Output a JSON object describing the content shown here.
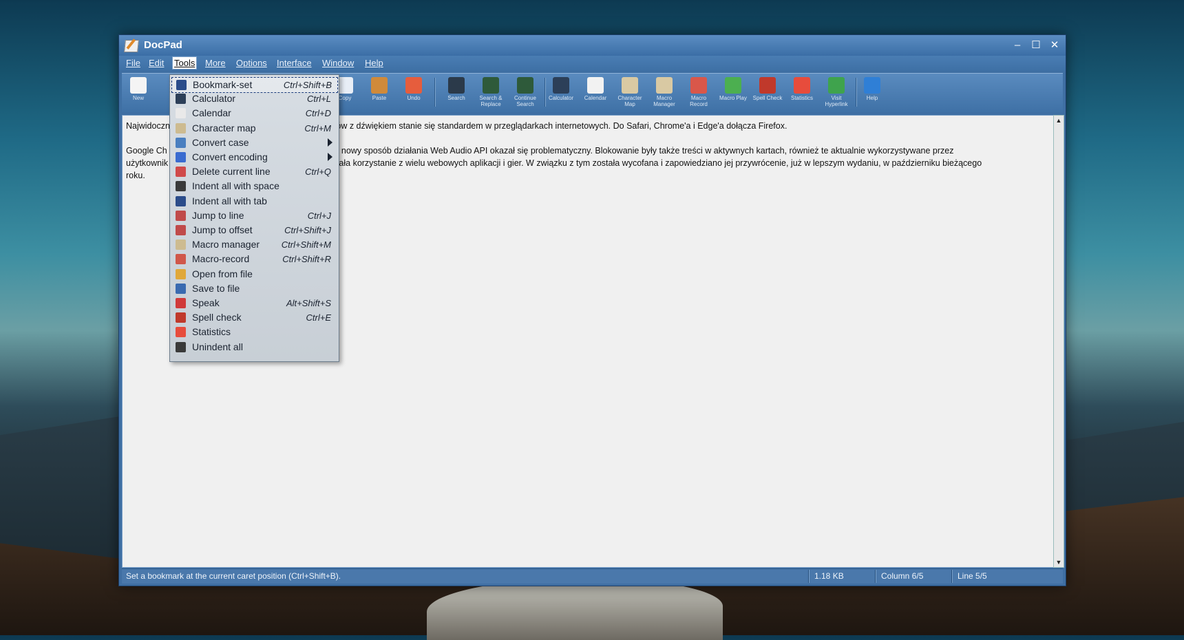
{
  "window": {
    "title": "DocPad",
    "minimize": "‒",
    "maximize": "☐",
    "close": "✕"
  },
  "menubar": [
    "File",
    "Edit",
    "Tools",
    "More",
    "Options",
    "Interface",
    "Window",
    "Help"
  ],
  "toolbar": [
    {
      "label": "New",
      "icon": "new-document-icon",
      "color": "#f4f4f4"
    },
    {
      "label": "Copy",
      "icon": "copy-icon",
      "color": "#e8eef6"
    },
    {
      "label": "Paste",
      "icon": "paste-icon",
      "color": "#d08a3a"
    },
    {
      "label": "Undo",
      "icon": "undo-icon",
      "color": "#e65d3d"
    },
    {
      "label": "Search",
      "icon": "binoculars-icon",
      "color": "#2b3a4a"
    },
    {
      "label": "Search & Replace",
      "icon": "search-replace-icon",
      "color": "#2e5a3a"
    },
    {
      "label": "Continue Search",
      "icon": "continue-search-icon",
      "color": "#2e5a3a"
    },
    {
      "label": "Calculator",
      "icon": "calculator-icon",
      "color": "#2c3f58"
    },
    {
      "label": "Calendar",
      "icon": "calendar-icon",
      "color": "#f2f2f2"
    },
    {
      "label": "Character Map",
      "icon": "character-map-icon",
      "color": "#d9c9a3"
    },
    {
      "label": "Macro Manager",
      "icon": "macro-manager-icon",
      "color": "#d9c9a3"
    },
    {
      "label": "Macro Record",
      "icon": "macro-record-icon",
      "color": "#d9574a"
    },
    {
      "label": "Macro Play",
      "icon": "macro-play-icon",
      "color": "#4caf50"
    },
    {
      "label": "Spell Check",
      "icon": "spell-check-icon",
      "color": "#c0392b"
    },
    {
      "label": "Statistics",
      "icon": "pie-chart-icon",
      "color": "#e74c3c"
    },
    {
      "label": "Visit Hyperlink",
      "icon": "globe-icon",
      "color": "#3fa34d"
    },
    {
      "label": "Help",
      "icon": "help-icon",
      "color": "#2f7fd6"
    }
  ],
  "editor": {
    "line1_start": "Najwidoczn",
    "line1_end": "filmów z dźwiękiem stanie się standardem w przeglądarkach internetowych. Do Safari, Chrome'a i Edge'a dołącza Firefox.",
    "para2_a_start": "Google Ch",
    "para2_a_end": "ale nowy sposób działania Web Audio API okazał się problematyczny. Blokowanie były także treści w aktywnych kartach, również te aktualnie wykorzystywane przez",
    "para2_b_start": "użytkownik",
    "para2_b_end": "trudniała korzystanie z wielu webowych aplikacji i gier. W związku z tym została wycofana i zapowiedziano jej przywrócenie, już w lepszym wydaniu, w październiku bieżącego",
    "para2_c": "roku."
  },
  "tools_menu": [
    {
      "label": "Bookmark-set",
      "shortcut": "Ctrl+Shift+B",
      "icon": "bookmark-icon",
      "color": "#2a4c8a",
      "selected": true
    },
    {
      "label": "Calculator",
      "shortcut": "Ctrl+L",
      "icon": "calculator-icon",
      "color": "#2c3f58"
    },
    {
      "label": "Calendar",
      "shortcut": "Ctrl+D",
      "icon": "calendar-icon",
      "color": "#e9e9e9"
    },
    {
      "label": "Character map",
      "shortcut": "Ctrl+M",
      "icon": "character-map-icon",
      "color": "#cdbb90"
    },
    {
      "label": "Convert case",
      "shortcut": "",
      "icon": "convert-case-icon",
      "color": "#4a7fc0",
      "submenu": true
    },
    {
      "label": "Convert encoding",
      "shortcut": "",
      "icon": "convert-encoding-icon",
      "color": "#3a6bd0",
      "submenu": true
    },
    {
      "label": "Delete current line",
      "shortcut": "Ctrl+Q",
      "icon": "delete-line-icon",
      "color": "#d04a4a"
    },
    {
      "label": "Indent all with space",
      "shortcut": "",
      "icon": "indent-space-icon",
      "color": "#3a3a3a"
    },
    {
      "label": "Indent all with tab",
      "shortcut": "",
      "icon": "indent-tab-icon",
      "color": "#2b4c8a"
    },
    {
      "label": "Jump to line",
      "shortcut": "Ctrl+J",
      "icon": "jump-line-icon",
      "color": "#c04a4a"
    },
    {
      "label": "Jump to offset",
      "shortcut": "Ctrl+Shift+J",
      "icon": "jump-offset-icon",
      "color": "#c04a4a"
    },
    {
      "label": "Macro manager",
      "shortcut": "Ctrl+Shift+M",
      "icon": "macro-manager-icon",
      "color": "#cdbb90"
    },
    {
      "label": "Macro-record",
      "shortcut": "Ctrl+Shift+R",
      "icon": "macro-record-icon",
      "color": "#d0574a"
    },
    {
      "label": "Open from file",
      "shortcut": "",
      "icon": "open-folder-icon",
      "color": "#e0a83a"
    },
    {
      "label": "Save to file",
      "shortcut": "",
      "icon": "save-icon",
      "color": "#3a6ab0"
    },
    {
      "label": "Speak",
      "shortcut": "Alt+Shift+S",
      "icon": "speak-icon",
      "color": "#d03a3a"
    },
    {
      "label": "Spell check",
      "shortcut": "Ctrl+E",
      "icon": "spell-check-icon",
      "color": "#c0392b"
    },
    {
      "label": "Statistics",
      "shortcut": "",
      "icon": "pie-chart-icon",
      "color": "#e74c3c"
    },
    {
      "label": "Unindent all",
      "shortcut": "",
      "icon": "unindent-icon",
      "color": "#3a3a3a"
    }
  ],
  "statusbar": {
    "message": "Set a bookmark at the current caret position (Ctrl+Shift+B).",
    "size": "1.18 KB",
    "column": "Column 6/5",
    "line": "Line 5/5"
  }
}
